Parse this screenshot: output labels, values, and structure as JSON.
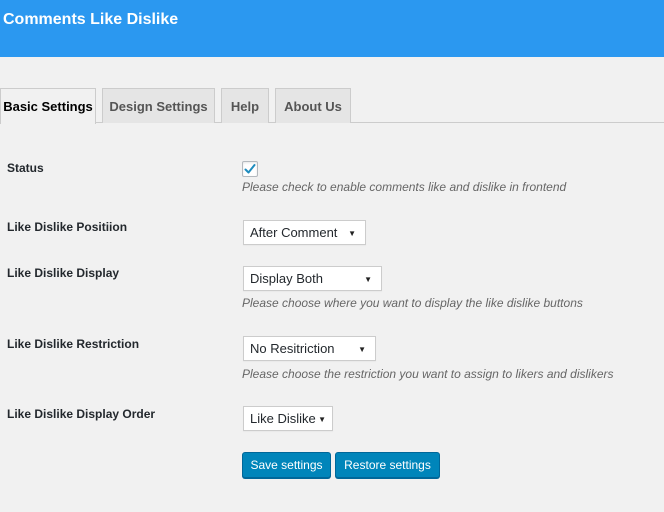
{
  "header": {
    "title": "Comments Like Dislike"
  },
  "tabs": [
    {
      "label": "Basic Settings",
      "active": true
    },
    {
      "label": "Design Settings",
      "active": false
    },
    {
      "label": "Help",
      "active": false
    },
    {
      "label": "About Us",
      "active": false
    }
  ],
  "settings": {
    "status": {
      "label": "Status",
      "checked": true,
      "description": "Please check to enable comments like and dislike in frontend"
    },
    "position": {
      "label": "Like Dislike Positiion",
      "value": "After Comment"
    },
    "display": {
      "label": "Like Dislike Display",
      "value": "Display Both",
      "description": "Please choose where you want to display the like dislike buttons"
    },
    "restriction": {
      "label": "Like Dislike Restriction",
      "value": "No Resitriction",
      "description": "Please choose the restriction you want to assign to likers and dislikers"
    },
    "order": {
      "label": "Like Dislike Display Order",
      "value": "Like Dislike"
    }
  },
  "buttons": {
    "save": "Save settings",
    "restore": "Restore settings"
  },
  "colors": {
    "header_bg": "#2b98f0",
    "button_bg": "#0085ba",
    "checkmark": "#1e8cbe"
  },
  "icons": {
    "select_caret": "▼"
  }
}
